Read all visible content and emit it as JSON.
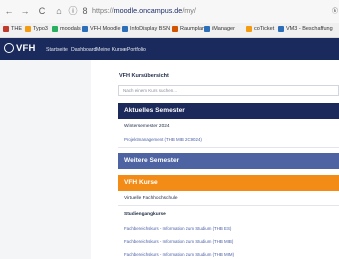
{
  "browser": {
    "nav": {
      "back": "←",
      "forward": "→",
      "reload": "C",
      "home": "⌂",
      "info": "ⓘ",
      "tracking": "8"
    },
    "url": {
      "scheme": "https://",
      "host": "moodle.oncampus.de",
      "path": "/my/"
    },
    "url_right": "ⓚ",
    "bookmarks": [
      {
        "label": "THE",
        "color": "#c0392b"
      },
      {
        "label": "Typo3",
        "color": "#f39c12"
      },
      {
        "label": "moodals",
        "color": "#27ae60"
      },
      {
        "label": "VFH Moodle",
        "color": "#2c6fb8"
      },
      {
        "label": "InfoDisplay BSN",
        "color": "#2c6fb8"
      },
      {
        "label": "Raumplan",
        "color": "#d35400"
      },
      {
        "label": "iManager",
        "color": "#2c6fb8"
      },
      {
        "label": "coTicket",
        "color": "#f39c12"
      },
      {
        "label": "VM3 - Beschaffung",
        "color": "#2c6fb8"
      }
    ]
  },
  "moodle": {
    "logo": "VFH",
    "menu": [
      "Startseite",
      "Dashboard",
      "Meine Kurse",
      "ePortfolio"
    ]
  },
  "main": {
    "course_overview": "VFH Kursübersicht",
    "search_placeholder": "Nach einem Kurs suchen...",
    "current_semester": "Aktuelles Semester",
    "semester_label": "Wintersemester 2024",
    "semester_course": "Projektmanagement (THB MIB 2C9024)",
    "further_semester": "Weitere Semester",
    "vfh_courses": "VFH Kurse",
    "virtual_school": "Virtuelle Fachhochschule",
    "studiengaenge": "Studiengangkurse",
    "links": [
      "Fachbereichskurs - Information zum Studium (THB ES)",
      "Fachbereichskurs - Information zum Studium (THB MIB)",
      "Fachbereichskurs - Information zum Studium (THB MIM)"
    ]
  }
}
